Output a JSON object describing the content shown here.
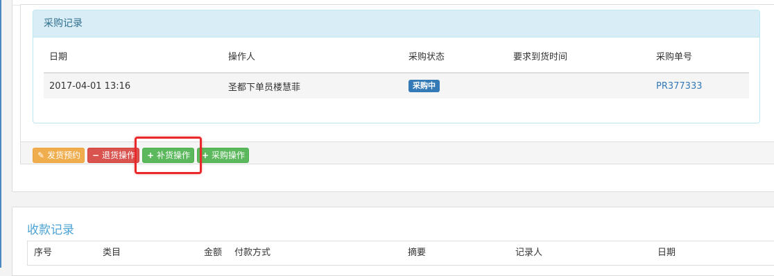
{
  "purchase_records": {
    "title": "采购记录",
    "columns": [
      "日期",
      "操作人",
      "采购状态",
      "要求到货时间",
      "采购单号"
    ],
    "rows": [
      {
        "date": "2017-04-01 13:16",
        "operator": "圣都下单员楼慧菲",
        "status": "采购中",
        "required_arrival": "",
        "po_number": "PR377333"
      }
    ]
  },
  "actions": {
    "ship_reservation": "发货预约",
    "return_operation": "退货操作",
    "restock_operation": "补货操作",
    "purchase_operation": "采购操作"
  },
  "receipt_records": {
    "title": "收款记录",
    "columns": [
      "序号",
      "类目",
      "金额",
      "付款方式",
      "摘要",
      "记录人",
      "日期"
    ]
  },
  "colors": {
    "info_heading_bg": "#d9edf7",
    "status_primary": "#337ab7",
    "warning": "#f0ad4e",
    "danger": "#d9534f",
    "success": "#5cb85c",
    "highlight": "#e8282b",
    "section_title": "#4ba3d4"
  },
  "icons": {
    "ship_reservation": "pencil-icon",
    "return_operation": "minus-icon",
    "restock_operation": "plus-icon",
    "purchase_operation": "plus-icon"
  }
}
